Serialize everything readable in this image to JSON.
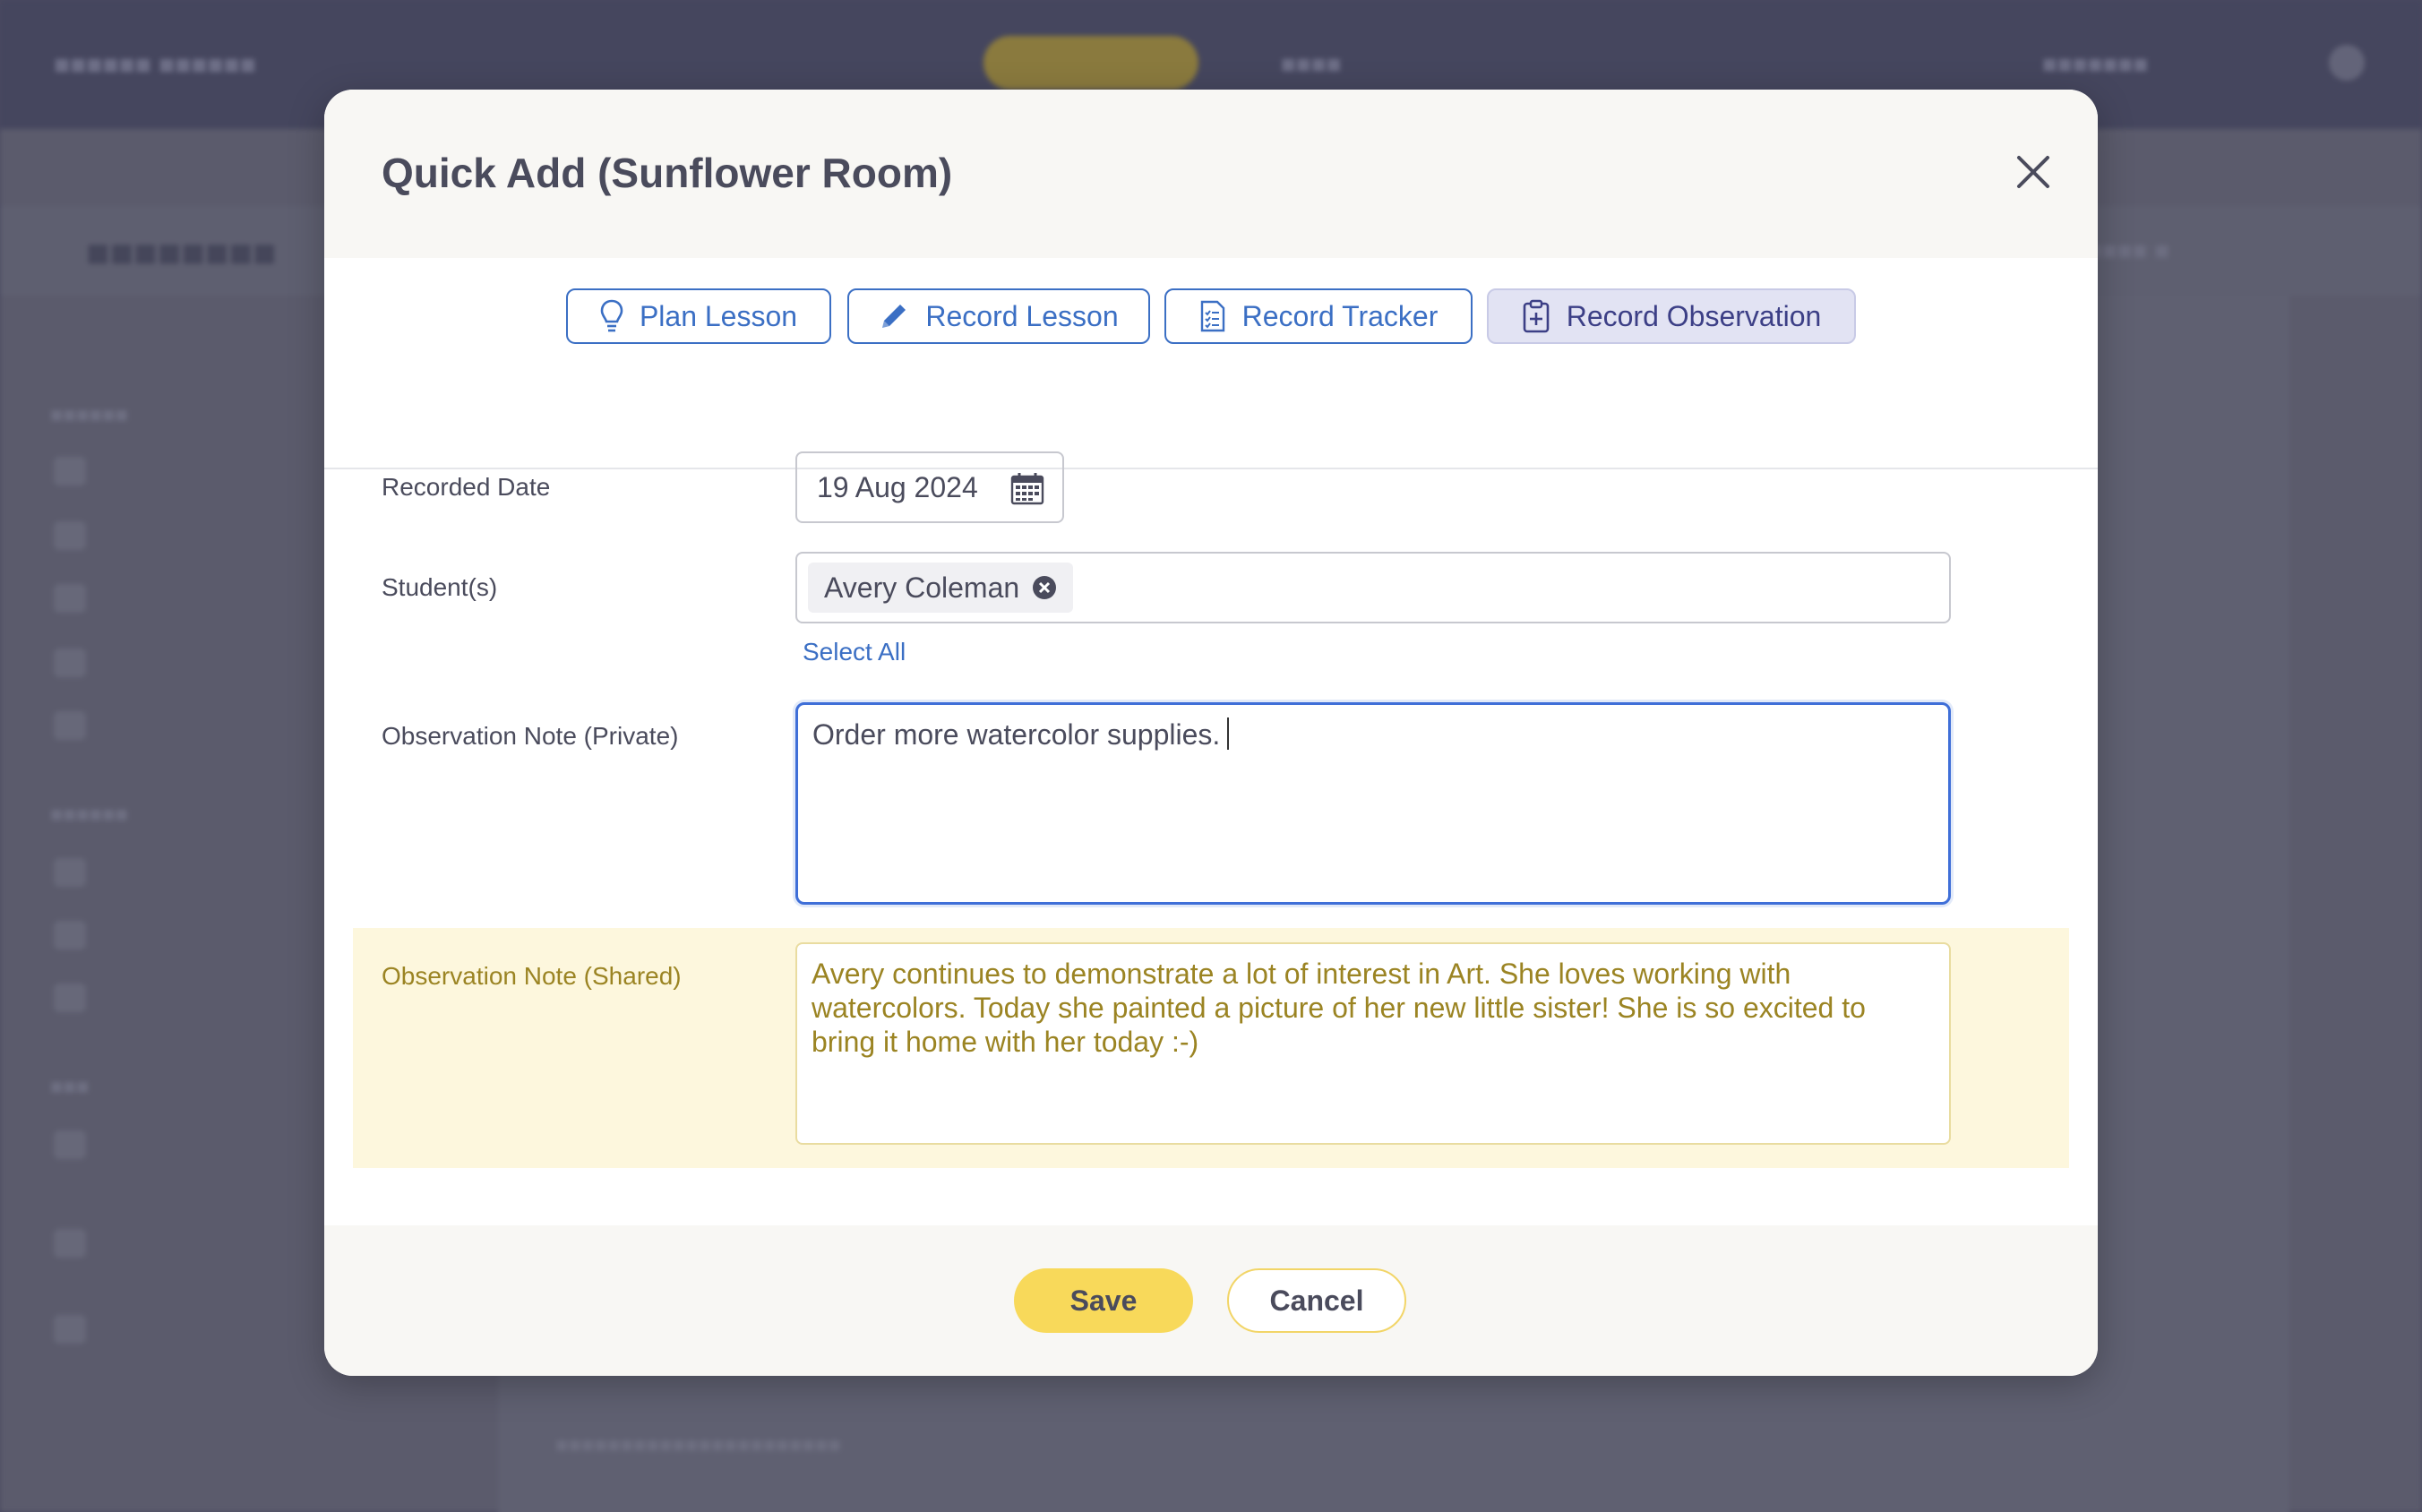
{
  "modal": {
    "title": "Quick Add (Sunflower Room)",
    "close_icon": "close-icon"
  },
  "tabs": [
    {
      "label": "Plan Lesson",
      "icon": "lightbulb-icon",
      "active": false
    },
    {
      "label": "Record Lesson",
      "icon": "pencil-icon",
      "active": false
    },
    {
      "label": "Record Tracker",
      "icon": "checklist-icon",
      "active": false
    },
    {
      "label": "Record Observation",
      "icon": "clipboard-plus-icon",
      "active": true
    }
  ],
  "form": {
    "recorded_date": {
      "label": "Recorded Date",
      "value": "19 Aug 2024",
      "icon": "calendar-icon"
    },
    "students": {
      "label": "Student(s)",
      "chips": [
        {
          "name": "Avery Coleman"
        }
      ],
      "select_all": "Select All"
    },
    "private_note": {
      "label": "Observation Note (Private)",
      "value": "Order more watercolor supplies."
    },
    "shared_note": {
      "label": "Observation Note (Shared)",
      "value": "Avery continues to demonstrate a lot of interest in Art. She loves working with watercolors. Today she painted a picture of her new little sister! She is so excited to bring it home with her today :-)"
    }
  },
  "footer": {
    "save_label": "Save",
    "cancel_label": "Cancel"
  },
  "colors": {
    "accent_blue": "#3b6fc4",
    "save_yellow": "#f8d95a",
    "shared_bg": "#fdf7dd",
    "shared_text": "#9b8423"
  }
}
